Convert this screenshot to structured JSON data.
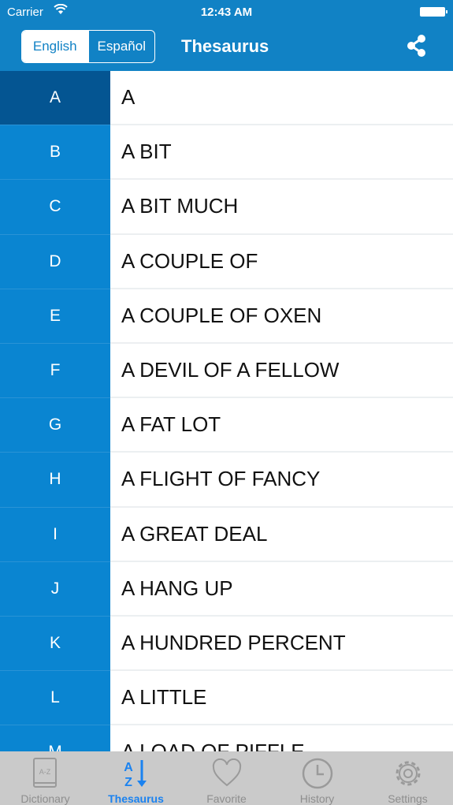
{
  "status_bar": {
    "carrier": "Carrier",
    "time": "12:43 AM"
  },
  "header": {
    "languages": [
      {
        "label": "English",
        "selected": true
      },
      {
        "label": "Español",
        "selected": false
      }
    ],
    "title": "Thesaurus",
    "share_icon": "share-icon"
  },
  "rows": [
    {
      "letter": "A",
      "term": "A",
      "active": true
    },
    {
      "letter": "B",
      "term": "A BIT"
    },
    {
      "letter": "C",
      "term": "A BIT MUCH"
    },
    {
      "letter": "D",
      "term": "A COUPLE OF"
    },
    {
      "letter": "E",
      "term": "A COUPLE OF OXEN"
    },
    {
      "letter": "F",
      "term": "A DEVIL OF A FELLOW"
    },
    {
      "letter": "G",
      "term": "A FAT LOT"
    },
    {
      "letter": "H",
      "term": "A FLIGHT OF FANCY"
    },
    {
      "letter": "I",
      "term": "A GREAT DEAL"
    },
    {
      "letter": "J",
      "term": "A HANG UP"
    },
    {
      "letter": "K",
      "term": "A HUNDRED PERCENT"
    },
    {
      "letter": "L",
      "term": "A LITTLE"
    },
    {
      "letter": "M",
      "term": "A LOAD OF PIFFLE"
    }
  ],
  "tabbar": {
    "tabs": [
      {
        "label": "Dictionary",
        "icon": "dictionary-book-icon"
      },
      {
        "label": "Thesaurus",
        "icon": "az-sort-icon",
        "active": true
      },
      {
        "label": "Favorite",
        "icon": "heart-icon"
      },
      {
        "label": "History",
        "icon": "clock-icon"
      },
      {
        "label": "Settings",
        "icon": "gear-icon"
      }
    ]
  },
  "colors": {
    "brand": "#1182c5",
    "letter_column": "#0a85d1",
    "active_letter": "#045592",
    "tab_active": "#1a82f0"
  }
}
